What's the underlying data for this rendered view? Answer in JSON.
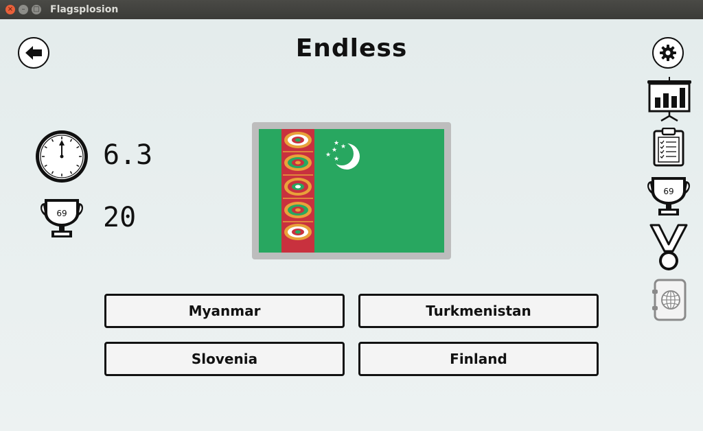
{
  "window": {
    "title": "Flagsplosion",
    "close_glyph": "×",
    "minimize_glyph": "–",
    "maximize_glyph": "□"
  },
  "header": {
    "title": "Endless",
    "back_icon": "arrow-left-icon",
    "settings_icon": "gear-icon"
  },
  "stats": {
    "timer": {
      "icon": "stopwatch-icon",
      "value": "6.3"
    },
    "score": {
      "icon": "trophy-icon",
      "badge": "69",
      "value": "20"
    }
  },
  "flag": {
    "country": "Turkmenistan",
    "colors": {
      "field": "#28a760",
      "stripe": "#c8313e",
      "crescent": "#ffffff"
    }
  },
  "answers": [
    {
      "label": "Myanmar"
    },
    {
      "label": "Turkmenistan"
    },
    {
      "label": "Slovenia"
    },
    {
      "label": "Finland"
    }
  ],
  "sidebar": {
    "items": [
      {
        "icon": "stats-board-icon"
      },
      {
        "icon": "clipboard-icon"
      },
      {
        "icon": "trophy-icon",
        "badge": "69"
      },
      {
        "icon": "medal-icon"
      },
      {
        "icon": "world-safe-icon"
      }
    ]
  }
}
